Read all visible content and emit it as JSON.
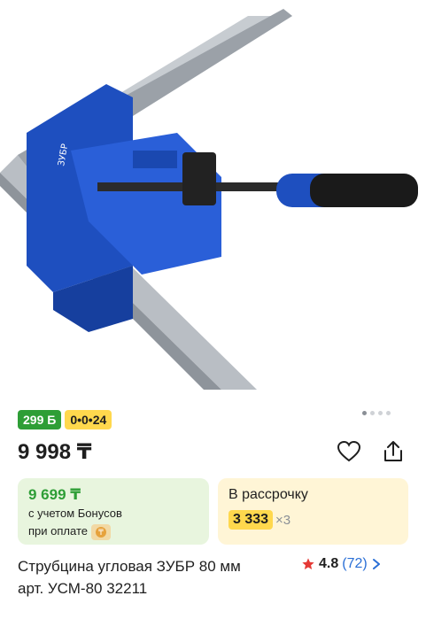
{
  "badges": {
    "bonus": "299 Б",
    "installment": "0•0•24"
  },
  "price": "9 998 ₸",
  "bonus_card": {
    "amount": "9 699 ₸",
    "line1": "с учетом Бонусов",
    "line2": "при оплате"
  },
  "installment_card": {
    "title": "В рассрочку",
    "amount": "3 333",
    "multiplier": "×3"
  },
  "product": {
    "title_line1": "Струбцина угловая ЗУБР 80 мм",
    "title_line2": "арт. УСМ-80 32211"
  },
  "rating": {
    "score": "4.8",
    "count": "(72)"
  },
  "carousel": {
    "total": 4,
    "active": 0
  },
  "colors": {
    "accent_green": "#2e9e36",
    "accent_yellow": "#ffd84d",
    "link_blue": "#2a6fd6",
    "star_red": "#e53935"
  },
  "icons": [
    "heart-icon",
    "share-icon",
    "star-icon",
    "chevron-right-icon",
    "payment-icon"
  ]
}
